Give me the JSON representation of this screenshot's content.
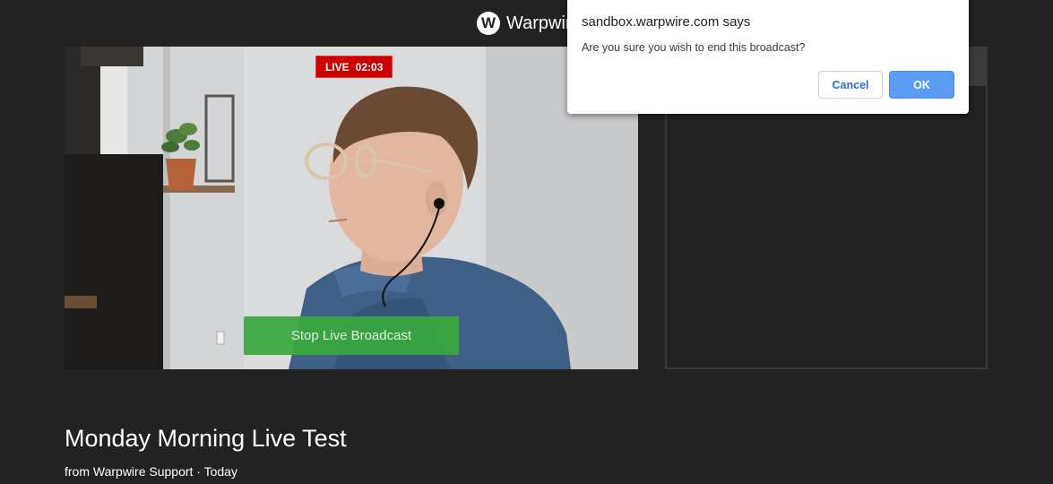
{
  "header": {
    "logo_letter": "W",
    "brand_name": "Warpwire"
  },
  "player": {
    "live_label": "LIVE",
    "elapsed": "02:03",
    "stop_button_label": "Stop Live Broadcast"
  },
  "video_info": {
    "title": "Monday Morning Live Test",
    "meta": "from Warpwire Support · Today"
  },
  "dialog": {
    "title": "sandbox.warpwire.com says",
    "message": "Are you sure you wish to end this broadcast?",
    "cancel_label": "Cancel",
    "ok_label": "OK"
  },
  "colors": {
    "page_background": "#222222",
    "live_badge": "#cc0000",
    "stop_button": "#38a83c",
    "ok_button": "#5b9af5",
    "cancel_text": "#2a6fd1"
  }
}
